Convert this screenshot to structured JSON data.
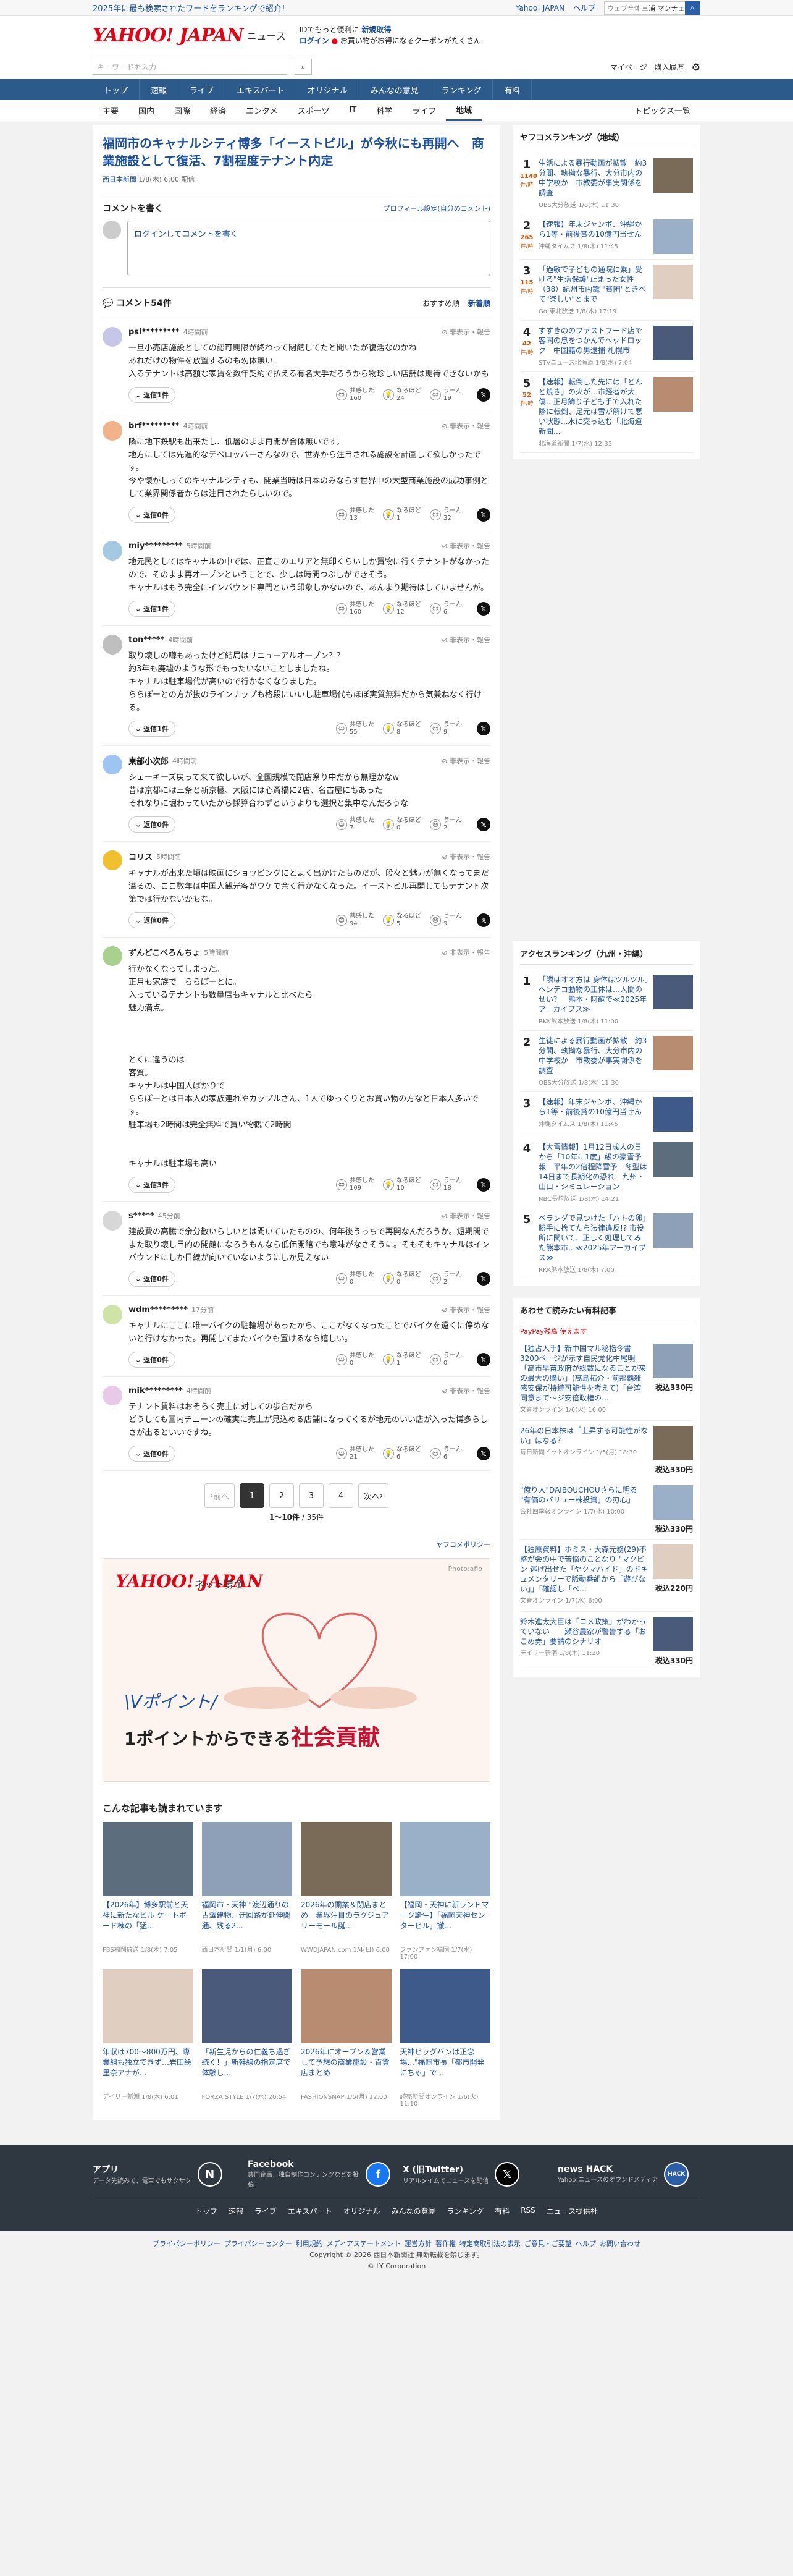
{
  "top_bar": {
    "promo": "2025年に最も検索されたワードをランキングで紹介！",
    "yahoo_japan": "Yahoo! JAPAN",
    "help": "ヘルプ",
    "search_placeholder": "ウェブ全体",
    "search_value": "三浦 マンチェ..."
  },
  "header": {
    "logo": "YAHOO! JAPAN",
    "section": "ニュース",
    "login_line1": "IDでもっと便利に",
    "login_new": "新規取得",
    "login_line2": "ログイン",
    "coupon": "お買い物がお得になるクーポンがたくさん"
  },
  "search": {
    "placeholder": "キーワードを入力",
    "mypage": "マイページ",
    "pay": "購入履歴"
  },
  "nav": [
    "トップ",
    "速報",
    "ライブ",
    "エキスパート",
    "オリジナル",
    "みんなの意見",
    "ランキング",
    "有料"
  ],
  "subnav": [
    "主要",
    "国内",
    "国際",
    "経済",
    "エンタメ",
    "スポーツ",
    "IT",
    "科学",
    "ライフ",
    "地域"
  ],
  "subnav_right": "トピックス一覧",
  "article": {
    "title": "福岡市のキャナルシティ博多「イーストビル」が今秋にも再開へ　商業施設として復活、7割程度テナント内定",
    "source": "西日本新聞",
    "date": "1/8(木) 6:00",
    "delivery": "配信"
  },
  "comment_form": {
    "heading": "コメントを書く",
    "profile": "プロフィール設定(自分のコメント)",
    "prompt": "ログインしてコメントを書く"
  },
  "comment_list": {
    "count": "コメント54件",
    "sort_rec": "おすすめ順",
    "sort_new": "新着順"
  },
  "comments": [
    {
      "user": "psl*********",
      "time": "4時間前",
      "report": "非表示・報告",
      "text": "一旦小売店施設としての認可期限が終わって閉館してたと聞いたが復活なのかね\nあれだけの物件を放置するのも勿体無い\n入るテナントは高額な家賃を数年契約で払える有名大手だろうから物珍しい店舗は期待できないかも",
      "reply": "返信1件",
      "a": "共感した",
      "a_n": "160",
      "b": "なるほど",
      "b_n": "24",
      "c": "うーん",
      "c_n": "19"
    },
    {
      "user": "brf*********",
      "time": "4時間前",
      "report": "非表示・報告",
      "text": "隣に地下鉄駅も出来たし、低層のまま再開が合体無いです。\n地方にしては先進的なデベロッパーさんなので、世界から注目される施設を計画して欲しかったです。\n今や懐かしってのキャナルシティも、開業当時は日本のみならず世界中の大型商業施設の成功事例として業界関係者からは注目されたらしいので。",
      "reply": "返信0件",
      "a": "共感した",
      "a_n": "13",
      "b": "なるほど",
      "b_n": "1",
      "c": "うーん",
      "c_n": "32"
    },
    {
      "user": "miy*********",
      "time": "5時間前",
      "report": "非表示・報告",
      "text": "地元民としてはキャナルの中では、正直このエリアと無印くらいしか買物に行くテナントがなかったので、そのまま再オープンということで、少しは時間つぶしができそう。\nキャナルはもう完全にインバウンド専門という印象しかないので、あんまり期待はしていませんが。",
      "reply": "返信1件",
      "a": "共感した",
      "a_n": "160",
      "b": "なるほど",
      "b_n": "12",
      "c": "うーん",
      "c_n": "6"
    },
    {
      "user": "ton*****",
      "time": "4時間前",
      "report": "非表示・報告",
      "text": "取り壊しの噂もあったけど結局はリニューアルオープン？？\n約3年も廃墟のような形でもったいないことしましたね。\nキャナルは駐車場代が高いので行かなくなりました。\nららぽーとの方が抜のラインナップも格段にいいし駐車場代もほぼ実質無料だから気兼ねなく行ける。",
      "reply": "返信1件",
      "a": "共感した",
      "a_n": "55",
      "b": "なるほど",
      "b_n": "8",
      "c": "うーん",
      "c_n": "9"
    },
    {
      "user": "東部小次郎",
      "time": "4時間前",
      "report": "非表示・報告",
      "text": "シェーキーズ戻って来て欲しいが、全国規模で閉店祭り中だから無理かなw\n昔は京都には三条と新京極、大阪には心斎橋に2店、名古屋にもあった\nそれなりに堀わっていたから採算合わずというよりも選択と集中なんだろうな",
      "reply": "返信0件",
      "a": "共感した",
      "a_n": "7",
      "b": "なるほど",
      "b_n": "0",
      "c": "うーん",
      "c_n": "2"
    },
    {
      "user": "コリス",
      "time": "5時間前",
      "report": "非表示・報告",
      "text": "キャナルが出来た頃は映画にショッピングにとよく出かけたものだが、段々と魅力が無くなってまだ溢るの、ここ数年は中国人観光客がウケで余く行かなくなった。イーストビル再開してもテナント次第では行かないかもな。",
      "reply": "返信0件",
      "a": "共感した",
      "a_n": "94",
      "b": "なるほど",
      "b_n": "5",
      "c": "うーん",
      "c_n": "9"
    },
    {
      "user": "ずんどこべろんちょ",
      "time": "5時間前",
      "report": "非表示・報告",
      "text": "行かなくなってしまった。\n正月も家族で　ららぽーとに。\n入っているテナントも数量店もキャナルと比べたら\n魅力満点。\n\n\n\nとくに違うのは\n客質。\nキャナルは中国人ばかりで\nららぽーとは日本人の家族連れやカップルさん、1人でゆっくりとお買い物の方など日本人多いです。\n駐車場も2時間は完全無料で買い物観て2時間\n\n\nキャナルは駐車場も高い",
      "reply": "返信3件",
      "a": "共感した",
      "a_n": "109",
      "b": "なるほど",
      "b_n": "10",
      "c": "うーん",
      "c_n": "18"
    },
    {
      "user": "s*****",
      "time": "45分前",
      "report": "非表示・報告",
      "text": "建設費の高騰で余分散いらしいとは聞いていたものの、何年後うっちで再開なんだろうか。短期間でまた取り壊し目的の開館になろうもんなら低価開館でも意味がなさそうに。そもそもキャナルはインバウンドにしか目線が向いていないようにしか見えない",
      "reply": "返信0件",
      "a": "共感した",
      "a_n": "0",
      "b": "なるほど",
      "b_n": "0",
      "c": "うーん",
      "c_n": "2"
    },
    {
      "user": "wdm*********",
      "time": "17分前",
      "report": "非表示・報告",
      "text": "キャナルにここに唯一バイクの駐輪場があったから、ここがなくなったことでバイクを遠くに停めないと行けなかった。再開してまたバイクも置けるなら嬉しい。",
      "reply": "返信0件",
      "a": "共感した",
      "a_n": "0",
      "b": "なるほど",
      "b_n": "1",
      "c": "うーん",
      "c_n": "0"
    },
    {
      "user": "mik*********",
      "time": "4時間前",
      "report": "非表示・報告",
      "text": "テナント賃料はおそらく売上に対しての歩合だから\nどうしても国内チェーンの確実に売上が見込める店舗になってくるが地元のいい店が入った博多らしさが出るといいですね。",
      "reply": "返信0件",
      "a": "共感した",
      "a_n": "21",
      "b": "なるほど",
      "b_n": "6",
      "c": "うーん",
      "c_n": "6"
    }
  ],
  "pager": {
    "prev": "前へ",
    "pages": [
      "1",
      "2",
      "3",
      "4"
    ],
    "next": "次へ",
    "range": "1〜10件",
    "total": "/ 35件"
  },
  "policy": "ヤフコメポリシー",
  "ad": {
    "brand": "YAHOO! JAPAN",
    "name": "ネット募金",
    "credit": "Photo:afio",
    "line1": "\\Vポイント/",
    "line2_a": "1ポイントからできる",
    "line2_b": "社会貢献"
  },
  "more": {
    "heading": "こんな記事も読まれています",
    "items": [
      {
        "title": "【2026年】博多駅前と天神に新たなビル ケートボード棟の「猛...",
        "meta": "FBS福岡放送 1/8(木) 7:05"
      },
      {
        "title": "福岡市・天神 \"渡辺通りの古澤建物、迂回路が延伸開通、残る2...",
        "meta": "西日本新聞 1/1(月) 6:00"
      },
      {
        "title": "2026年の開業＆閉店まとめ　業界注目のラグジュアリーモール誕...",
        "meta": "WWDJAPAN.com 1/4(日) 6:00"
      },
      {
        "title": "【福岡・天神に新ランドマーク誕生】「福岡天神センタービル」撤...",
        "meta": "ファンファン福岡 1/7(水) 17:00"
      },
      {
        "title": "年収は700〜800万円、専業組も独立できず…岩田絵里奈アナが...",
        "meta": "デイリー新潮 1/8(木) 6:01"
      },
      {
        "title": "「新生児からの仁義ち過ぎ続く！」新幹線の指定席で体験し...",
        "meta": "FORZA STYLE 1/7(水) 20:54"
      },
      {
        "title": "2026年にオープン＆営業して予想の商業施設・百貨店まとめ",
        "meta": "FASHIONSNAP 1/5(月) 12:00"
      },
      {
        "title": "天神ビッグバンは正念場...\"福岡市長「都市開発にちゃ」で...",
        "meta": "読売新聞オンライン 1/6(火) 11:10"
      }
    ]
  },
  "ranking": {
    "heading": "ヤフコメランキング（地域）",
    "items": [
      {
        "rank": "1",
        "count": "1140",
        "unit": "件/時",
        "title": "生活による暴行動画が拡散　約3分間、執拗な暴行、大分市内の中学校か　市教委が事実関係を調査",
        "meta": "OBS大分放送 1/8(木) 11:30"
      },
      {
        "rank": "2",
        "count": "265",
        "unit": "件/時",
        "title": "【速報】年末ジャンボ、沖縄から1等・前後賞の10億円当せん",
        "meta": "沖縄タイムス 1/8(木) 11:45"
      },
      {
        "rank": "3",
        "count": "115",
        "unit": "件/時",
        "title": "「過敏で子どもの通院に乗」受けろ\"生活保護\"止まった女性（38）紀州市内籠 \"貧困\"ときべて\"楽しい\"とまで",
        "meta": "Go:東北放送 1/8(木) 17:19"
      },
      {
        "rank": "4",
        "count": "42",
        "unit": "件/時",
        "title": "すすきののファストフード店で客同の息をつかんでヘッドロック　中国籍の男逮捕 札幌市",
        "meta": "STVニュース北海道 1/8(木) 7:04"
      },
      {
        "rank": "5",
        "count": "52",
        "unit": "件/時",
        "title": "【速報】転倒した先には「どんど焼き」の火が…市経者が大傷...正月飾り子ども手で入れた際に転倒、足元は雪が解けて悪い状態...水に交っ込む「北海道新聞...",
        "meta": "北海道新聞 1/7(水) 12:33"
      }
    ]
  },
  "access": {
    "heading": "アクセスランキング（九州・沖縄）",
    "items": [
      {
        "rank": "1",
        "title": "「隣はオオ方は 身体はツルツル」ヘンテコ動物の正体は…人間のせい？　熊本・阿蘇で≪2025年アーカイブス≫",
        "meta": "RKK熊本放送 1/8(木) 11:00"
      },
      {
        "rank": "2",
        "title": "生徒による暴行動画が拡散　約3分間、執拗な暴行、大分市内の中学校か　市教委が事実関係を調査",
        "meta": "OBS大分放送 1/8(木) 11:30"
      },
      {
        "rank": "3",
        "title": "【速報】年末ジャンボ、沖縄から1等・前後賞の10億円当せん",
        "meta": "沖縄タイムス 1/8(木) 11:45"
      },
      {
        "rank": "4",
        "title": "【大雪情報】1月12日成人の日から「10年に1度」級の豪雪予報　平年の2倍程降雪予　冬型は14日まで長期化の恐れ　九州・山口・シミュレーション",
        "meta": "NBC長崎放送 1/8(木) 14:21"
      },
      {
        "rank": "5",
        "title": "ベランダで見つけた「ハトの卵」勝手に捨てたら法律違反!? 市役所に聞いて、正しく処理してみた熊本市...≪2025年アーカイブス≫",
        "meta": "RKK熊本放送 1/8(木) 7:00"
      }
    ]
  },
  "paid": {
    "heading": "あわせて読みたい有料記事",
    "sub": "PayPay残高 使えます",
    "items": [
      {
        "title": "【独占入手】新中国マル秘指令書3200ページが示す自民党化中尾明「高市早苗政府が総裁になることが来の最大の購い」(高島拓介・前那覇雑感安保が持続可能性を考えて)「台湾同意まで〜ジ安倍政権の…",
        "meta": "文春オンライン 1/6(火) 16:00",
        "price": "税込330円"
      },
      {
        "title": "26年の日本株は「上昇する可能性がない」はなる？",
        "meta": "毎日新聞ドットオンライン 1/5(月) 18:30",
        "price": "税込330円"
      },
      {
        "title": "\"億り人\"DAIBOUCHOUさらに明る \"有価のバリュー株投資」の刃心」",
        "meta": "会社四季報オンライン 1/7(水) 10:00",
        "price": "税込330円"
      },
      {
        "title": "【独原資料】ホミス・大森元務(29)不整が会の中で苦悩のことなり \"マクビン 逃げ出せた「ヤクマハイド」のドキュメンタリーで脈動番組から「遊びない」」「確認し「ベ…",
        "meta": "文春オンライン 1/7(水) 6:00",
        "price": "税込220円"
      },
      {
        "title": "鈴木進太大臣は「コメ政策」がわかっていない　　瀬谷農家が警告する「おこめ券」要請のシナリオ",
        "meta": "デイリー新潮 1/8(木) 11:30",
        "price": "税込330円"
      }
    ]
  },
  "footer": {
    "apps": [
      {
        "name": "アプリ",
        "desc": "データ先読みで、電車でもサクサク"
      },
      {
        "name": "Facebook",
        "desc": "共同企画、独自制作コンテンツなどを投稿"
      },
      {
        "name": "X (旧Twitter)",
        "desc": "リアルタイムでニュースを配信"
      },
      {
        "name": "news HACK",
        "desc": "Yahoo!ニュースのオウンドメディア"
      }
    ],
    "links": [
      "トップ",
      "速報",
      "ライブ",
      "エキスパート",
      "オリジナル",
      "みんなの意見",
      "ランキング",
      "有料",
      "RSS",
      "ニュース提供社"
    ],
    "bottom_links": [
      "プライバシーポリシー",
      "プライバシーセンター",
      "利用規約",
      "メディアステートメント",
      "運営方針",
      "著作権",
      "特定商取引法の表示",
      "ご意見・ご要望",
      "ヘルプ",
      "お問い合わせ"
    ],
    "copyright": "Copyright © 2026 西日本新聞社 無断転載を禁じます。",
    "corp": "© LY Corporation"
  },
  "colors": {
    "brand": "#e60012",
    "nav": "#2c5a8a",
    "link": "#1a4fa0"
  }
}
